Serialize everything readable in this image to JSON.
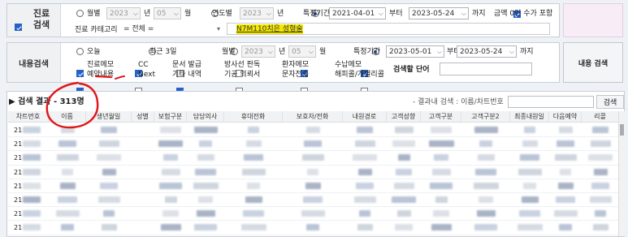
{
  "top_panel": {
    "label": "진료\n검색",
    "radio_month": "월별",
    "year_value": "2023",
    "year_unit": "년",
    "month_value": "05",
    "month_unit": "월",
    "radio_yearly": "연도별",
    "yearly_value": "2023",
    "yearly_unit": "년",
    "radio_period": "특정기간",
    "period_from": "2021-04-01",
    "from_suffix": "부터",
    "period_to": "2023-05-24",
    "to_suffix": "까지",
    "zero_amount_label": "금액 0인 수가 포함",
    "category_label": "진료 카테고리",
    "category_value": "= 전체 =",
    "code_value": "N7M110치은 성형술"
  },
  "content_panel": {
    "label": "내용검색",
    "radio_today": "오늘",
    "radio_recent3": "최근 3일",
    "radio_month": "월별",
    "year_value": "2023",
    "year_unit": "년",
    "month_value": "05",
    "month_unit": "월",
    "radio_period": "특정기간",
    "period_from": "2023-05-01",
    "from_suffix": "부터",
    "period_to": "2023-05-24",
    "to_suffix": "까지",
    "search_button": "내용 검색",
    "search_word_label": "검색할 단어",
    "checkboxes_row1": [
      {
        "label": "진료메모",
        "checked": true
      },
      {
        "label": "CC",
        "checked": true
      },
      {
        "label": "문서 발급",
        "checked": false
      },
      {
        "label": "방사선 판독",
        "checked": false
      },
      {
        "label": "환자메모",
        "checked": true
      },
      {
        "label": "수납메모",
        "checked": true
      }
    ],
    "checkboxes_row2": [
      {
        "label": "예약내용",
        "checked": true
      },
      {
        "label": "Next",
        "checked": false
      },
      {
        "label": "기타 내역",
        "checked": true
      },
      {
        "label": "기공 의뢰서",
        "checked": false
      },
      {
        "label": "문자전송",
        "checked": false
      },
      {
        "label": "해피콜/개별리콜",
        "checked": false
      }
    ]
  },
  "results": {
    "title_prefix": "▶ 검색 결과",
    "count_text": "- 313명",
    "inline_search_label": "- 결과내 검색 : 이름/차트번호",
    "search_button": "검색",
    "columns": [
      "차트번호",
      "이름",
      "생년월일",
      "성별",
      "보험구분",
      "담당의사",
      "휴대전화",
      "보호자/전화",
      "내원경로",
      "고객성향",
      "고객구분",
      "고객구분2",
      "최종내원일",
      "다음예약",
      "리콜"
    ],
    "row_prefix": [
      "21",
      "21",
      "21",
      "21",
      "21",
      "21",
      "21",
      "21"
    ]
  },
  "colors": {
    "accent": "#2462c9",
    "highlight": "#f5e800",
    "annotation": "#e0151b",
    "pink_panel": "#f8ecf7"
  }
}
